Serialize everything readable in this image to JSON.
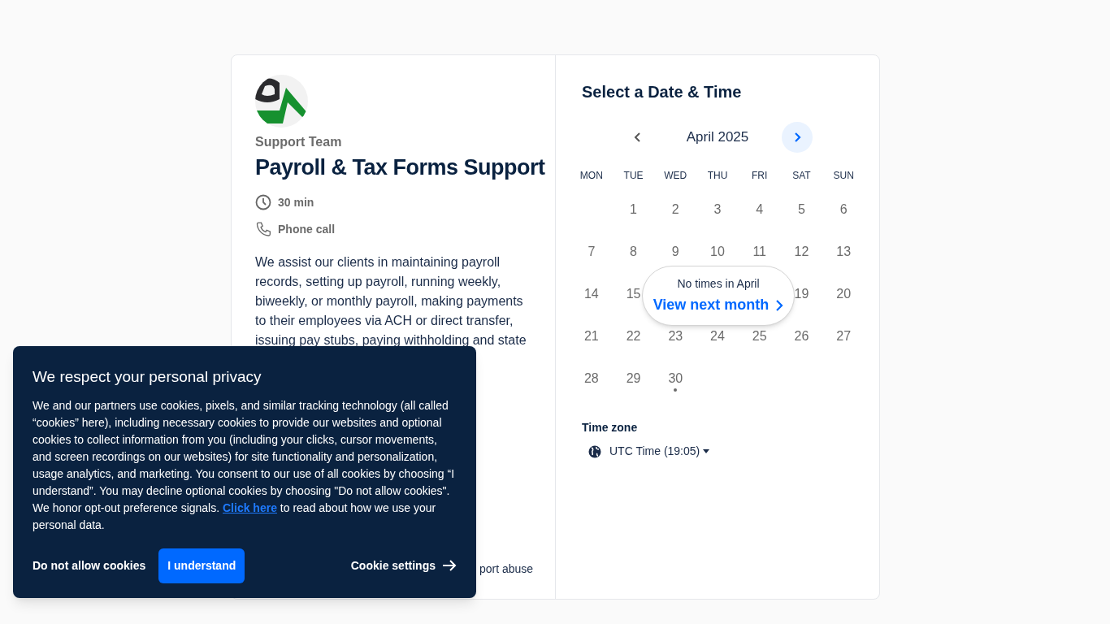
{
  "organizer": "Support Team",
  "event_title": "Payroll & Tax Forms Support",
  "details": [
    {
      "kind": "duration",
      "text": "30 min"
    },
    {
      "kind": "phone",
      "text": "Phone call"
    }
  ],
  "description": [
    "We assist our clients in maintaining payroll",
    "records, setting up payroll, running weekly,",
    "biweekly, or monthly payroll, making payments",
    "to their employees via ACH or direct transfer,",
    "issuing pay stubs, paying withholding and state"
  ],
  "report_link": "port abuse",
  "calendar": {
    "title": "Select a Date & Time",
    "month": "April 2025",
    "weekdays": [
      "MON",
      "TUE",
      "WED",
      "THU",
      "FRI",
      "SAT",
      "SUN"
    ],
    "days": [
      {
        "kind": "blank"
      },
      {
        "kind": "day",
        "label": "1"
      },
      {
        "kind": "day",
        "label": "2"
      },
      {
        "kind": "day",
        "label": "3"
      },
      {
        "kind": "day",
        "label": "4"
      },
      {
        "kind": "day",
        "label": "5"
      },
      {
        "kind": "day",
        "label": "6"
      },
      {
        "kind": "day",
        "label": "7"
      },
      {
        "kind": "day",
        "label": "8"
      },
      {
        "kind": "day",
        "label": "9"
      },
      {
        "kind": "day",
        "label": "10"
      },
      {
        "kind": "day",
        "label": "11"
      },
      {
        "kind": "day",
        "label": "12"
      },
      {
        "kind": "day",
        "label": "13"
      },
      {
        "kind": "day",
        "label": "14"
      },
      {
        "kind": "day",
        "label": "15"
      },
      {
        "kind": "covered"
      },
      {
        "kind": "covered"
      },
      {
        "kind": "covered"
      },
      {
        "kind": "day",
        "label": "19"
      },
      {
        "kind": "day",
        "label": "20"
      },
      {
        "kind": "day",
        "label": "21"
      },
      {
        "kind": "day",
        "label": "22"
      },
      {
        "kind": "day",
        "label": "23"
      },
      {
        "kind": "day",
        "label": "24"
      },
      {
        "kind": "day",
        "label": "25"
      },
      {
        "kind": "day",
        "label": "26"
      },
      {
        "kind": "day",
        "label": "27"
      },
      {
        "kind": "day",
        "label": "28"
      },
      {
        "kind": "day",
        "label": "29"
      },
      {
        "kind": "day",
        "label": "30",
        "today": true
      }
    ],
    "popup": {
      "message": "No times in April",
      "action": "View next month"
    },
    "timezone_label": "Time zone",
    "timezone": "UTC Time (19:05)"
  },
  "cookie_banner": {
    "title": "We respect your personal privacy",
    "text_before": "We and our partners use cookies, pixels, and similar tracking technology (all called “cookies” here), including necessary cookies to provide our websites and optional cookies to collect information from you (including your clicks, cursor movements, and screen recordings on our websites) for site functionality and personalization, usage analytics, and marketing. You consent to our use of all cookies by choosing “I understand”. You may decline optional cookies by choosing \"Do not allow cookies\". We honor opt-out preference signals. ",
    "link": "Click here",
    "text_after": " to read about how we use your personal data.",
    "buttons": [
      {
        "kind": "text",
        "label": "Do not allow cookies"
      },
      {
        "kind": "primary",
        "label": "I understand"
      },
      {
        "kind": "arrow",
        "label": "Cookie settings"
      }
    ]
  }
}
